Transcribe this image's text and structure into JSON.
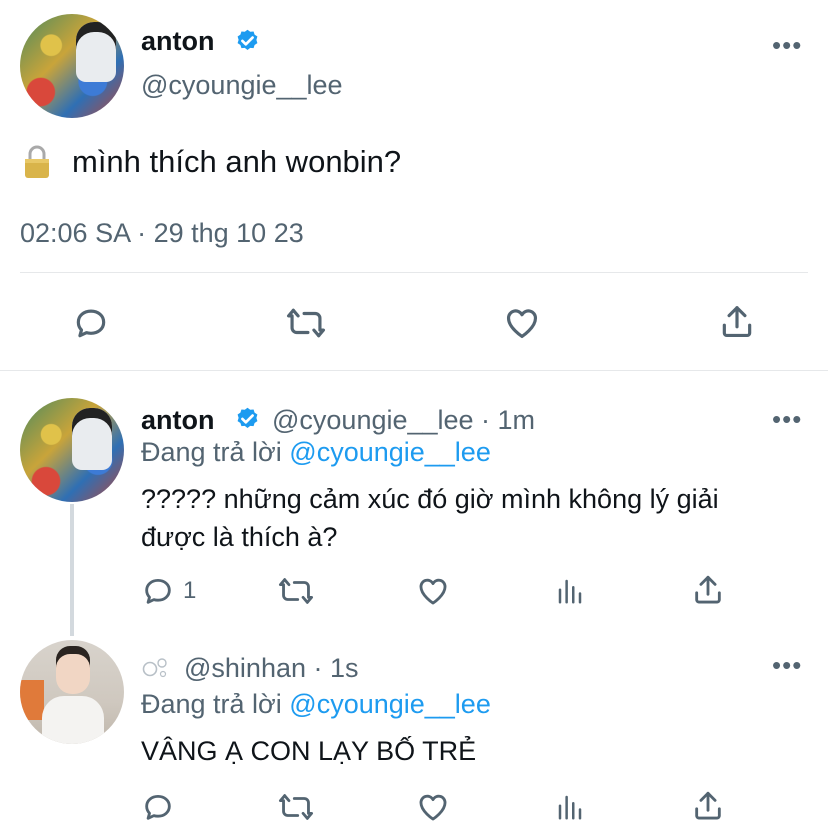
{
  "main_tweet": {
    "author_name": "anton",
    "author_handle": "@cyoungie__lee",
    "text": "mình thích anh wonbin?",
    "timestamp": "02:06 SA · 29 thg 10 23",
    "more_label": "•••"
  },
  "reply1": {
    "author_name": "anton",
    "meta": "@cyoungie__lee · 1m",
    "replying_prefix": "Đang trả lời",
    "replying_to": "@cyoungie__lee",
    "text_line1": "????? những cảm xúc đó giờ mình không lý giải",
    "text_line2": "được là thích à?",
    "reply_count": "1",
    "more_label": "•••"
  },
  "reply2": {
    "meta": "@shinhan · 1s",
    "replying_prefix": "Đang trả lời",
    "replying_to": "@cyoungie__lee",
    "text": "VÂNG Ạ CON LẠY BỐ TRẺ",
    "more_label": "•••"
  },
  "colors": {
    "verified": "#1d9bf0",
    "secondary_text": "#536471",
    "mention": "#1d9bf0"
  }
}
